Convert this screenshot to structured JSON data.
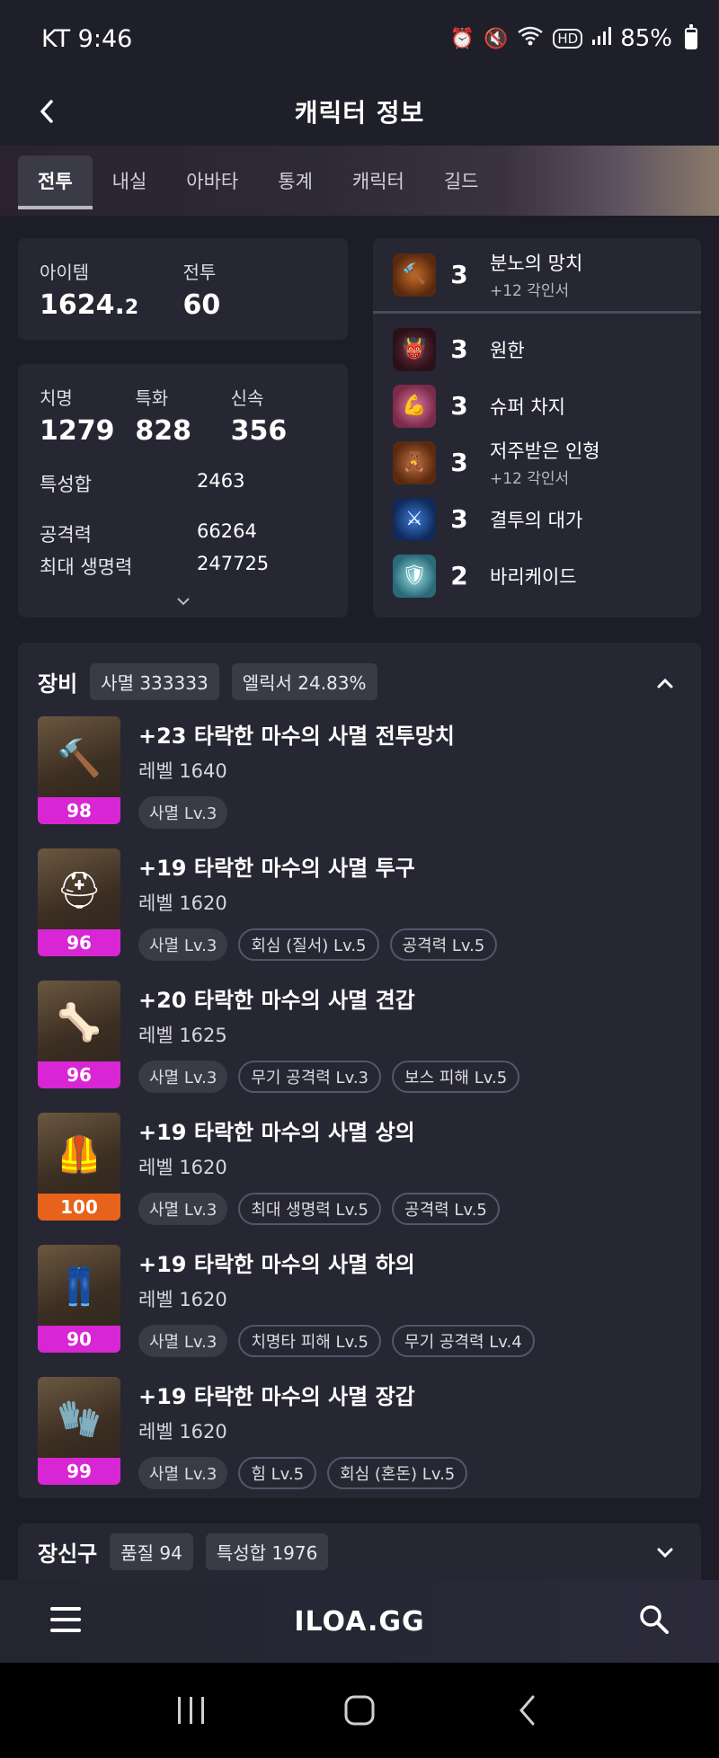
{
  "status_bar": {
    "carrier_time": "KT 9:46",
    "battery": "85%",
    "icons": [
      "alarm-icon",
      "mute-icon",
      "wifi-icon",
      "hd-icon",
      "signal-icon",
      "battery-icon"
    ]
  },
  "header": {
    "title": "캐릭터 정보"
  },
  "tabs": [
    {
      "label": "전투",
      "active": true
    },
    {
      "label": "내실"
    },
    {
      "label": "아바타"
    },
    {
      "label": "통계"
    },
    {
      "label": "캐릭터"
    },
    {
      "label": "길드"
    }
  ],
  "summary": {
    "item_label": "아이템",
    "item_value": "1624.",
    "item_value_decimal": "2",
    "combat_label": "전투",
    "combat_value": "60"
  },
  "stats": {
    "crit_label": "치명",
    "crit_value": "1279",
    "spec_label": "특화",
    "spec_value": "828",
    "swift_label": "신속",
    "swift_value": "356",
    "total_label": "특성합",
    "total_value": "2463",
    "atk_label": "공격력",
    "atk_value": "66264",
    "hp_label": "최대 생명력",
    "hp_value": "247725"
  },
  "engravings": [
    {
      "level": "3",
      "name": "분노의 망치",
      "sub": "+12 각인서",
      "icon": "hammer-icon"
    },
    {
      "level": "3",
      "name": "원한",
      "sub": "",
      "icon": "demon-icon"
    },
    {
      "level": "3",
      "name": "슈퍼 차지",
      "sub": "",
      "icon": "charge-icon"
    },
    {
      "level": "3",
      "name": "저주받은 인형",
      "sub": "+12 각인서",
      "icon": "doll-icon"
    },
    {
      "level": "3",
      "name": "결투의 대가",
      "sub": "",
      "icon": "duel-icon"
    },
    {
      "level": "2",
      "name": "바리케이드",
      "sub": "",
      "icon": "barricade-icon"
    }
  ],
  "equipment": {
    "title": "장비",
    "badge1": "사멸 333333",
    "badge2": "엘릭서 24.83%",
    "items": [
      {
        "name": "+23 타락한 마수의 사멸 전투망치",
        "level": "레벨 1640",
        "quality": "98",
        "quality_color": "#d826d4",
        "icon": "war-hammer-icon",
        "tags": [
          "사멸 Lv.3"
        ]
      },
      {
        "name": "+19 타락한 마수의 사멸 투구",
        "level": "레벨 1620",
        "quality": "96",
        "quality_color": "#d826d4",
        "icon": "helmet-icon",
        "tags": [
          "사멸 Lv.3",
          "회심 (질서) Lv.5",
          "공격력 Lv.5"
        ]
      },
      {
        "name": "+20 타락한 마수의 사멸 견갑",
        "level": "레벨 1625",
        "quality": "96",
        "quality_color": "#d826d4",
        "icon": "shoulder-icon",
        "tags": [
          "사멸 Lv.3",
          "무기 공격력 Lv.3",
          "보스 피해 Lv.5"
        ]
      },
      {
        "name": "+19 타락한 마수의 사멸 상의",
        "level": "레벨 1620",
        "quality": "100",
        "quality_color": "#e7631b",
        "icon": "chest-armor-icon",
        "tags": [
          "사멸 Lv.3",
          "최대 생명력 Lv.5",
          "공격력 Lv.5"
        ]
      },
      {
        "name": "+19 타락한 마수의 사멸 하의",
        "level": "레벨 1620",
        "quality": "90",
        "quality_color": "#d826d4",
        "icon": "pants-icon",
        "tags": [
          "사멸 Lv.3",
          "치명타 피해 Lv.5",
          "무기 공격력 Lv.4"
        ]
      },
      {
        "name": "+19 타락한 마수의 사멸 장갑",
        "level": "레벨 1620",
        "quality": "99",
        "quality_color": "#d826d4",
        "icon": "gloves-icon",
        "tags": [
          "사멸 Lv.3",
          "힘 Lv.5",
          "회심 (혼돈) Lv.5"
        ]
      }
    ]
  },
  "accessories": {
    "title": "장신구",
    "badge1": "품질 94",
    "badge2": "특성합 1976"
  },
  "bottom_bar": {
    "logo": "ILOA.GG"
  }
}
